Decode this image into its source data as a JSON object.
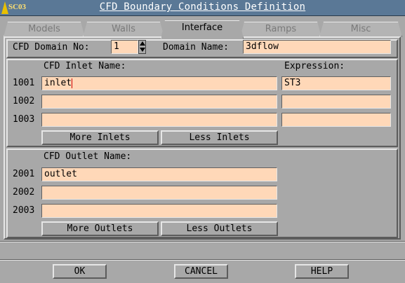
{
  "window": {
    "title": "CFD Boundary Conditions Definition",
    "app_badge": "SC03"
  },
  "tabs": [
    {
      "label": "Models",
      "active": false
    },
    {
      "label": "Walls",
      "active": false
    },
    {
      "label": "Interface",
      "active": true
    },
    {
      "label": "Ramps",
      "active": false
    },
    {
      "label": "Misc",
      "active": false
    }
  ],
  "domain": {
    "no_label": "CFD Domain No:",
    "no_value": "1",
    "name_label": "Domain Name:",
    "name_value": "3dflow"
  },
  "inlets": {
    "name_header": "CFD Inlet Name:",
    "expr_header": "Expression:",
    "rows": [
      {
        "id": "1001",
        "name": "inlet",
        "expression": "ST3"
      },
      {
        "id": "1002",
        "name": "",
        "expression": ""
      },
      {
        "id": "1003",
        "name": "",
        "expression": ""
      }
    ],
    "more_label": "More Inlets",
    "less_label": "Less Inlets"
  },
  "outlets": {
    "name_header": "CFD Outlet Name:",
    "rows": [
      {
        "id": "2001",
        "name": "outlet"
      },
      {
        "id": "2002",
        "name": ""
      },
      {
        "id": "2003",
        "name": ""
      }
    ],
    "more_label": "More Outlets",
    "less_label": "Less Outlets"
  },
  "footer": {
    "ok_label": "OK",
    "cancel_label": "CANCEL",
    "help_label": "HELP"
  },
  "colors": {
    "titlebar": "#5a7896",
    "field_bg": "#ffd8b8",
    "panel_bg": "#a8a8a8"
  }
}
